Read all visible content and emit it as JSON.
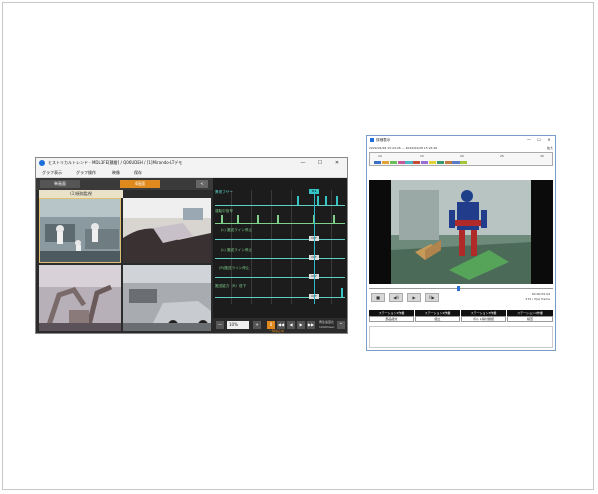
{
  "left_window": {
    "title": "ヒストリカルトレンド - MDL3FE[積層] / Q06UDEH / [1]Mirando-LTデモ",
    "controls": {
      "minimize": "—",
      "maximize": "☐",
      "close": "✕"
    },
    "menu": [
      "グラフ表示",
      "グラフ操作",
      "映像",
      "保存"
    ],
    "view_buttons": {
      "single": "単画面",
      "multi": "4画面",
      "collapse": "<"
    },
    "camera_label": "(1)焼鈍監視",
    "signals": [
      {
        "label": "異常ブザー",
        "state": "ON"
      },
      {
        "label": "運転中信号",
        "state": ""
      },
      {
        "label": "(L) 搬送ライン停止",
        "state": "OFF"
      },
      {
        "label": "(L) 搬送ライン停止",
        "state": "OFF"
      },
      {
        "label": "(R)搬送ライン停止",
        "state": "OFF"
      },
      {
        "label": "搬送能力（R）低下",
        "state": "OFF"
      }
    ],
    "bottom": {
      "zoom_value": "10%",
      "minus": "—",
      "plus": "+",
      "pause": "II",
      "prev": "◀◀",
      "back": "◀",
      "forward": "▶",
      "next": "▶▶",
      "up": "^",
      "speed_label": "一時停止中",
      "speed_right": "再生速度比",
      "speed_right2": "1000msec"
    }
  },
  "right_window": {
    "title": "詳細表示",
    "controls": {
      "minimize": "—",
      "maximize": "☐",
      "close": "✕"
    },
    "date_range": "2022/04/28 15:24:26 — 2022/04/28 15:24:26",
    "zoom_label": "拡大",
    "timeline_ticks": [
      "10",
      "15",
      "20",
      "25",
      "30"
    ],
    "timeline_colors": [
      "#3a6fc4",
      "#e2a23a",
      "#6bbf59",
      "#c45a9b",
      "#4db6c6",
      "#c44a3a",
      "#9a6fd4",
      "#e2d23a",
      "#3a9a6f",
      "#c47a3a",
      "#5a7ac4",
      "#a4c43a"
    ],
    "buttons": {
      "stop": "■",
      "step_back": "◀II",
      "play": "▶",
      "step_forward": "II▶"
    },
    "time_display": "00:00:05.04",
    "frame_display": "272 / 3(e) frame",
    "table": {
      "headers": [
        "ステーション1作業",
        "ステーション2作業",
        "ステーション3作業",
        "ステーション4作業"
      ],
      "cells": [
        "部品組付",
        "組立",
        "ボルト締付確認",
        "検査"
      ]
    }
  }
}
